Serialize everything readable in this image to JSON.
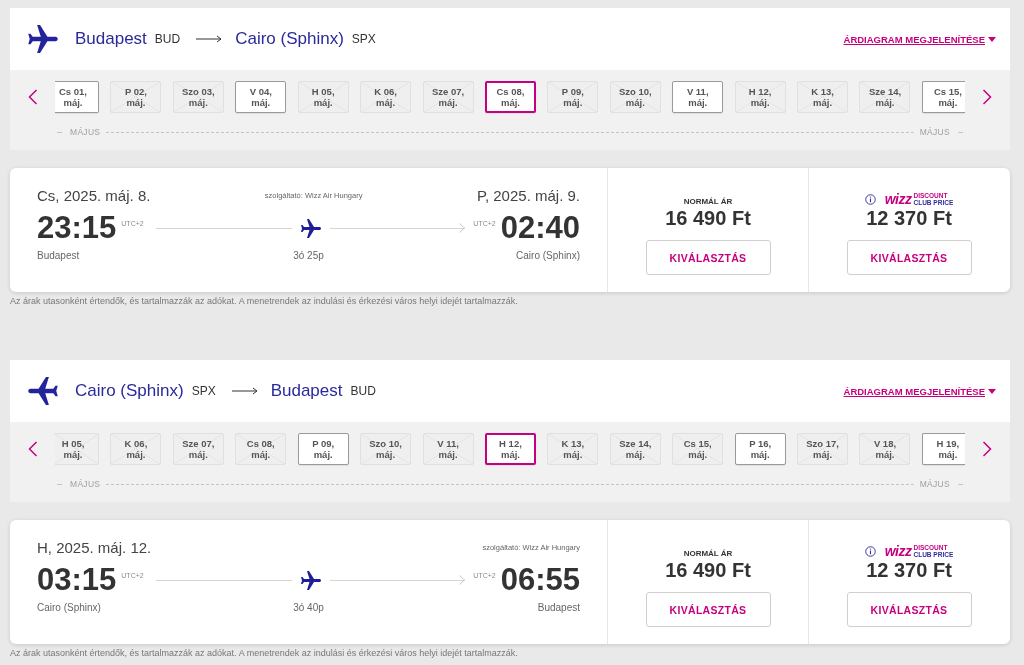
{
  "journeys": [
    {
      "kind": "outbound",
      "header": {
        "origin": {
          "city": "Budapest",
          "code": "BUD"
        },
        "destination": {
          "city": "Cairo (Sphinx)",
          "code": "SPX"
        },
        "chart_link": "ÁRDIAGRAM MEGJELENÍTÉSE"
      },
      "date_strip": {
        "month_start": "MÁJUS",
        "month_end": "MÁJUS",
        "dates": [
          {
            "day": "Cs 01,",
            "month": "máj.",
            "available": true,
            "selected": false
          },
          {
            "day": "P 02,",
            "month": "máj.",
            "available": false,
            "selected": false
          },
          {
            "day": "Szo 03,",
            "month": "máj.",
            "available": false,
            "selected": false
          },
          {
            "day": "V 04,",
            "month": "máj.",
            "available": true,
            "selected": false
          },
          {
            "day": "H 05,",
            "month": "máj.",
            "available": false,
            "selected": false
          },
          {
            "day": "K 06,",
            "month": "máj.",
            "available": false,
            "selected": false
          },
          {
            "day": "Sze 07,",
            "month": "máj.",
            "available": false,
            "selected": false
          },
          {
            "day": "Cs 08,",
            "month": "máj.",
            "available": true,
            "selected": true
          },
          {
            "day": "P 09,",
            "month": "máj.",
            "available": false,
            "selected": false
          },
          {
            "day": "Szo 10,",
            "month": "máj.",
            "available": false,
            "selected": false
          },
          {
            "day": "V 11,",
            "month": "máj.",
            "available": true,
            "selected": false
          },
          {
            "day": "H 12,",
            "month": "máj.",
            "available": false,
            "selected": false
          },
          {
            "day": "K 13,",
            "month": "máj.",
            "available": false,
            "selected": false
          },
          {
            "day": "Sze 14,",
            "month": "máj.",
            "available": false,
            "selected": false
          },
          {
            "day": "Cs 15,",
            "month": "máj.",
            "available": true,
            "selected": false
          }
        ]
      },
      "flight": {
        "departure_date": "Cs, 2025. máj. 8.",
        "operator": "szolgáltató: Wizz Air Hungary",
        "arrival_date": "P, 2025. máj. 9.",
        "departure_time": "23:15",
        "departure_tz": "UTC+2",
        "arrival_tz": "UTC+2",
        "arrival_time": "02:40",
        "origin": "Budapest",
        "duration": "3ó 25p",
        "destination": "Cairo (Sphinx)",
        "fares": [
          {
            "kind": "normal",
            "label": "NORMÁL ÁR",
            "price": "16 490 Ft",
            "button": "KIVÁLASZTÁS"
          },
          {
            "kind": "club",
            "logo": "wizz",
            "label_lines": [
              "DISCOUNT",
              "CLUB PRICE"
            ],
            "price": "12 370 Ft",
            "button": "KIVÁLASZTÁS"
          }
        ]
      },
      "note": "Az árak utasonként értendők, és tartalmazzák az adókat. A menetrendek az indulási és érkezési város helyi idejét tartalmazzák."
    },
    {
      "kind": "return",
      "header": {
        "origin": {
          "city": "Cairo (Sphinx)",
          "code": "SPX"
        },
        "destination": {
          "city": "Budapest",
          "code": "BUD"
        },
        "chart_link": "ÁRDIAGRAM MEGJELENÍTÉSE"
      },
      "date_strip": {
        "month_start": "MÁJUS",
        "month_end": "MÁJUS",
        "dates": [
          {
            "day": "H 05,",
            "month": "máj.",
            "available": false,
            "selected": false
          },
          {
            "day": "K 06,",
            "month": "máj.",
            "available": false,
            "selected": false
          },
          {
            "day": "Sze 07,",
            "month": "máj.",
            "available": false,
            "selected": false
          },
          {
            "day": "Cs 08,",
            "month": "máj.",
            "available": false,
            "selected": false
          },
          {
            "day": "P 09,",
            "month": "máj.",
            "available": true,
            "selected": false
          },
          {
            "day": "Szo 10,",
            "month": "máj.",
            "available": false,
            "selected": false
          },
          {
            "day": "V 11,",
            "month": "máj.",
            "available": false,
            "selected": false
          },
          {
            "day": "H 12,",
            "month": "máj.",
            "available": true,
            "selected": true
          },
          {
            "day": "K 13,",
            "month": "máj.",
            "available": false,
            "selected": false
          },
          {
            "day": "Sze 14,",
            "month": "máj.",
            "available": false,
            "selected": false
          },
          {
            "day": "Cs 15,",
            "month": "máj.",
            "available": false,
            "selected": false
          },
          {
            "day": "P 16,",
            "month": "máj.",
            "available": true,
            "selected": false
          },
          {
            "day": "Szo 17,",
            "month": "máj.",
            "available": false,
            "selected": false
          },
          {
            "day": "V 18,",
            "month": "máj.",
            "available": false,
            "selected": false
          },
          {
            "day": "H 19,",
            "month": "máj.",
            "available": true,
            "selected": false
          }
        ]
      },
      "flight": {
        "departure_date": "H, 2025. máj. 12.",
        "operator": "szolgáltató: Wizz Air Hungary",
        "departure_time": "03:15",
        "departure_tz": "UTC+2",
        "arrival_tz": "UTC+2",
        "arrival_time": "06:55",
        "origin": "Cairo (Sphinx)",
        "duration": "3ó 40p",
        "destination": "Budapest",
        "fares": [
          {
            "kind": "normal",
            "label": "NORMÁL ÁR",
            "price": "16 490 Ft",
            "button": "KIVÁLASZTÁS"
          },
          {
            "kind": "club",
            "logo": "wizz",
            "label_lines": [
              "DISCOUNT",
              "CLUB PRICE"
            ],
            "price": "12 370 Ft",
            "button": "KIVÁLASZTÁS"
          }
        ]
      },
      "note": "Az árak utasonként értendők, és tartalmazzák az adókat. A menetrendek az indulási és érkezési város helyi idejét tartalmazzák."
    }
  ]
}
